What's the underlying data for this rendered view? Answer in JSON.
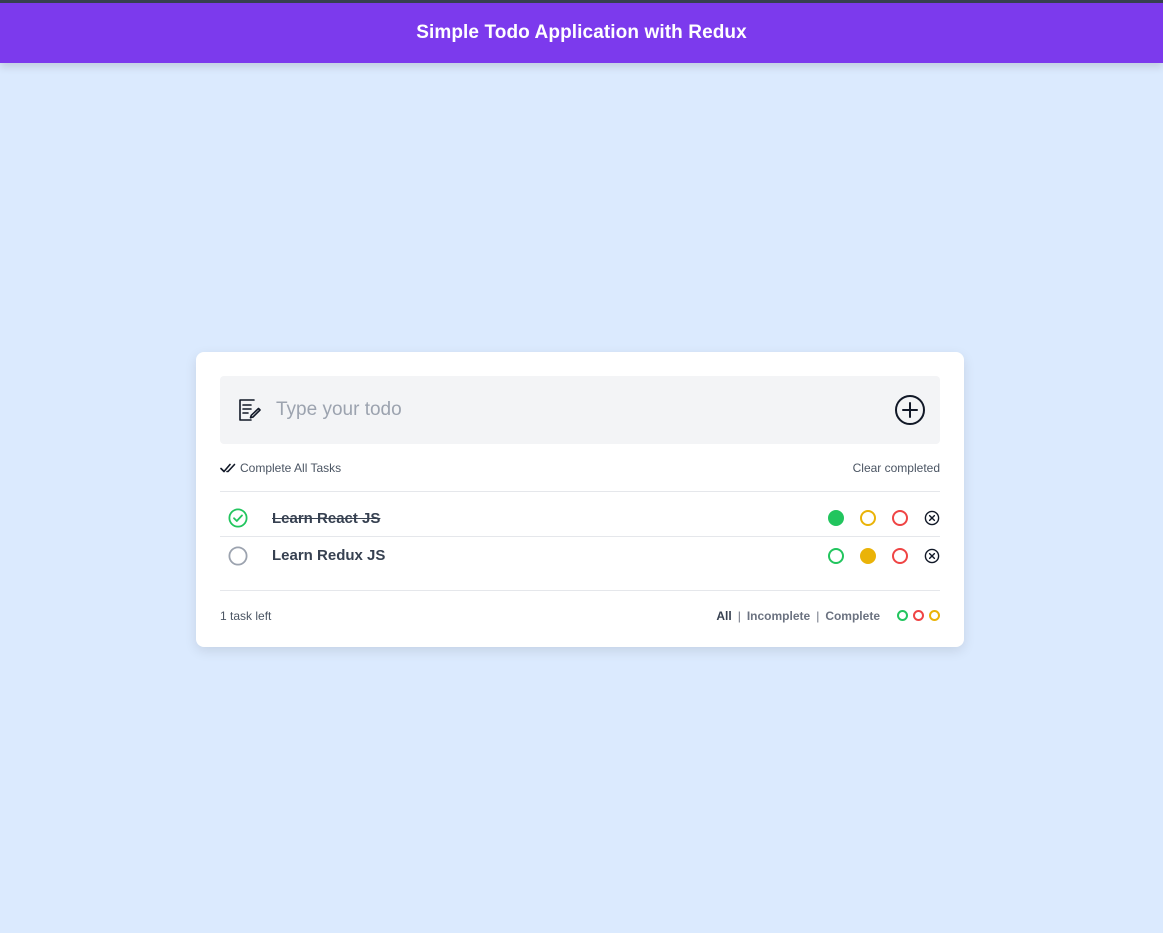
{
  "app": {
    "title": "Simple Todo Application with Redux"
  },
  "input": {
    "placeholder": "Type your todo",
    "value": ""
  },
  "actions": {
    "complete_all_label": "Complete All Tasks",
    "clear_completed_label": "Clear completed"
  },
  "todos": [
    {
      "text": "Learn React JS",
      "completed": true,
      "color": "green"
    },
    {
      "text": "Learn Redux JS",
      "completed": false,
      "color": "yellow"
    }
  ],
  "footer": {
    "tasks_left": "1 task left",
    "filters": [
      "All",
      "Incomplete",
      "Complete"
    ],
    "active_filter": "All",
    "separator": "|"
  },
  "colors": {
    "header": "#7c3aed",
    "background": "#dbeafe",
    "green": "#22c55e",
    "yellow": "#eab308",
    "red": "#ef4444"
  },
  "icons": {
    "input_icon": "note-edit-icon",
    "add_icon": "plus-circle-icon",
    "complete_all_icon": "double-check-icon",
    "delete_icon": "x-circle-icon"
  }
}
